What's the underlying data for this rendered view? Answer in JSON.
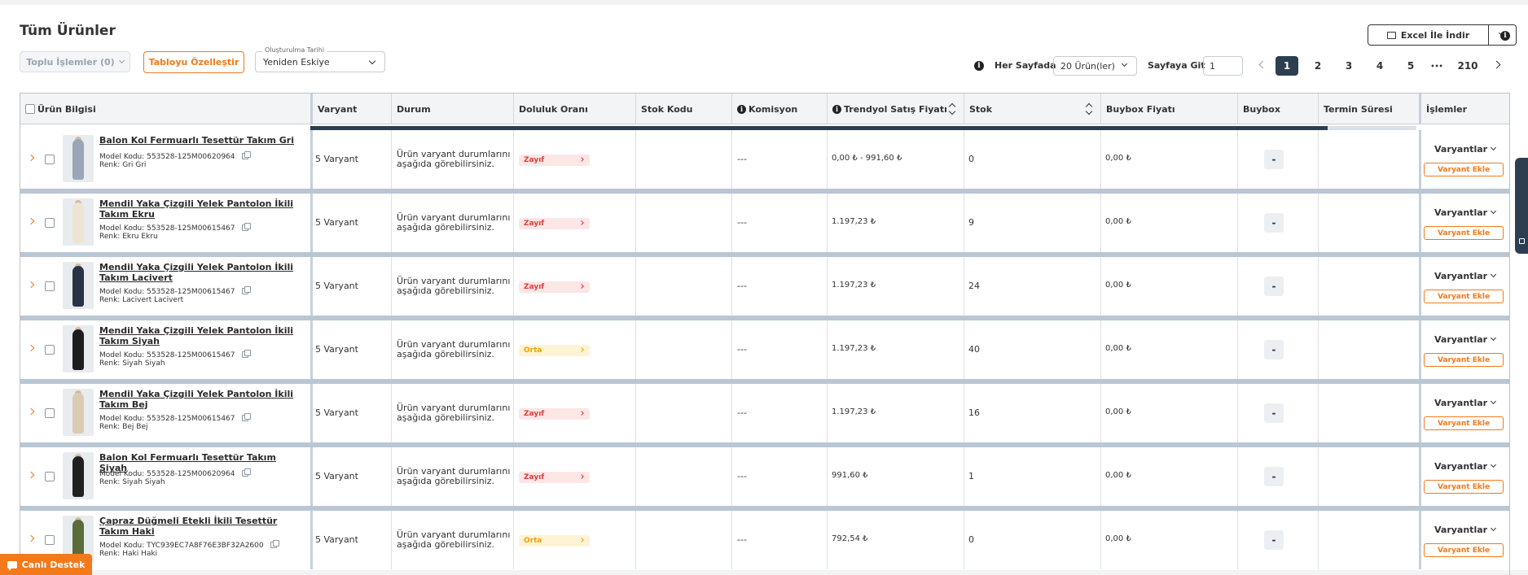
{
  "page": {
    "title": "Tüm Ürünler"
  },
  "toolbar": {
    "bulk_actions": "Toplu İşlemler (0)",
    "customize_table": "Tabloyu Özelleştir",
    "sort_legend": "Oluşturulma Tarihi",
    "sort_value": "Yeniden Eskiye",
    "per_page_label": "Her Sayfada",
    "per_page_value": "20 Ürün(ler)",
    "goto_label": "Sayfaya Git",
    "goto_value": "1",
    "excel_label": "Excel İle İndir"
  },
  "pagination": {
    "current": "1",
    "pages": [
      "1",
      "2",
      "3",
      "4",
      "5",
      "•••",
      "210"
    ]
  },
  "columns": {
    "urun_bilgisi": "Ürün Bilgisi",
    "varyant": "Varyant",
    "durum": "Durum",
    "doluluk": "Doluluk Oranı",
    "stok_kodu": "Stok Kodu",
    "komisyon": "Komisyon",
    "satis_fiyati": "Trendyol Satış Fiyatı",
    "stok": "Stok",
    "buybox_fiyati": "Buybox Fiyatı",
    "buybox": "Buybox",
    "termin": "Termin Süresi",
    "islemler": "İşlemler"
  },
  "loading_progress": 0.92,
  "rows": [
    {
      "name": "Balon Kol Fermuarlı Tesettür Takım Gri",
      "model": "Model Kodu: 553528-125M00620964",
      "color": "Renk: Gri Gri",
      "variant": "5 Varyant",
      "status": "Ürün varyant durumlarını aşağıda görebilirsiniz.",
      "fill": "Zayıf",
      "fill_level": "zayif",
      "stock_code": "",
      "commission": "---",
      "price": "0,00 ₺ - 991,60 ₺",
      "stock": "0",
      "buybox_price": "0,00 ₺",
      "buybox": "-",
      "termin": "",
      "variants_btn": "Varyantlar",
      "add_variant": "Varyant Ekle",
      "outfit_color": "#9aa6b6"
    },
    {
      "name": "Mendil Yaka Çizgili Yelek Pantolon İkili Takım Ekru",
      "model": "Model Kodu: 553528-125M00615467",
      "color": "Renk: Ekru Ekru",
      "variant": "5 Varyant",
      "status": "Ürün varyant durumlarını aşağıda görebilirsiniz.",
      "fill": "Zayıf",
      "fill_level": "zayif",
      "stock_code": "",
      "commission": "---",
      "price": "1.197,23 ₺",
      "stock": "9",
      "buybox_price": "0,00 ₺",
      "buybox": "-",
      "termin": "",
      "variants_btn": "Varyantlar",
      "add_variant": "Varyant Ekle",
      "outfit_color": "#ece5d6"
    },
    {
      "name": "Mendil Yaka Çizgili Yelek Pantolon İkili Takım Lacivert",
      "model": "Model Kodu: 553528-125M00615467",
      "color": "Renk: Lacivert Lacivert",
      "variant": "5 Varyant",
      "status": "Ürün varyant durumlarını aşağıda görebilirsiniz.",
      "fill": "Zayıf",
      "fill_level": "zayif",
      "stock_code": "",
      "commission": "---",
      "price": "1.197,23 ₺",
      "stock": "24",
      "buybox_price": "0,00 ₺",
      "buybox": "-",
      "termin": "",
      "variants_btn": "Varyantlar",
      "add_variant": "Varyant Ekle",
      "outfit_color": "#2a3246"
    },
    {
      "name": "Mendil Yaka Çizgili Yelek Pantolon İkili Takım Siyah",
      "model": "Model Kodu: 553528-125M00615467",
      "color": "Renk: Siyah Siyah",
      "variant": "5 Varyant",
      "status": "Ürün varyant durumlarını aşağıda görebilirsiniz.",
      "fill": "Orta",
      "fill_level": "orta",
      "stock_code": "",
      "commission": "---",
      "price": "1.197,23 ₺",
      "stock": "40",
      "buybox_price": "0,00 ₺",
      "buybox": "-",
      "termin": "",
      "variants_btn": "Varyantlar",
      "add_variant": "Varyant Ekle",
      "outfit_color": "#1d1d1f"
    },
    {
      "name": "Mendil Yaka Çizgili Yelek Pantolon İkili Takım Bej",
      "model": "Model Kodu: 553528-125M00615467",
      "color": "Renk: Bej Bej",
      "variant": "5 Varyant",
      "status": "Ürün varyant durumlarını aşağıda görebilirsiniz.",
      "fill": "Zayıf",
      "fill_level": "zayif",
      "stock_code": "",
      "commission": "---",
      "price": "1.197,23 ₺",
      "stock": "16",
      "buybox_price": "0,00 ₺",
      "buybox": "-",
      "termin": "",
      "variants_btn": "Varyantlar",
      "add_variant": "Varyant Ekle",
      "outfit_color": "#dccbb4"
    },
    {
      "name": "Balon Kol Fermuarlı Tesettür Takım Siyah",
      "model": "Model Kodu: 553528-125M00620964",
      "color": "Renk: Siyah Siyah",
      "variant": "5 Varyant",
      "status": "Ürün varyant durumlarını aşağıda görebilirsiniz.",
      "fill": "Zayıf",
      "fill_level": "zayif",
      "stock_code": "",
      "commission": "---",
      "price": "991,60 ₺",
      "stock": "1",
      "buybox_price": "0,00 ₺",
      "buybox": "-",
      "termin": "",
      "variants_btn": "Varyantlar",
      "add_variant": "Varyant Ekle",
      "outfit_color": "#202022"
    },
    {
      "name": "Çapraz Düğmeli Etekli İkili Tesettür Takım Haki",
      "model": "Model Kodu: TYC939EC7A8F76E3BF32A2600",
      "color": "Renk: Haki Haki",
      "variant": "5 Varyant",
      "status": "Ürün varyant durumlarını aşağıda görebilirsiniz.",
      "fill": "Orta",
      "fill_level": "orta",
      "stock_code": "",
      "commission": "---",
      "price": "792,54 ₺",
      "stock": "0",
      "buybox_price": "0,00 ₺",
      "buybox": "-",
      "termin": "",
      "variants_btn": "Varyantlar",
      "add_variant": "Varyant Ekle",
      "outfit_color": "#5c6b3a"
    }
  ],
  "footer": {
    "live_support": "Canlı Destek"
  },
  "colors": {
    "accent": "#f27a1a",
    "dark": "#2d3e50",
    "weak": "#e23b3b",
    "medium": "#f2a200"
  }
}
